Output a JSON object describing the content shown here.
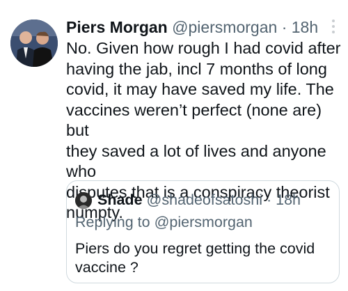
{
  "tweet": {
    "author_name": "Piers Morgan",
    "author_handle": "@piersmorgan",
    "separator": "·",
    "time": "18h",
    "text": "No. Given how rough I had covid after\nhaving the jab, incl 7 months of long\ncovid, it may have saved my life. The\nvaccines weren’t perfect (none are) but\nthey saved a lot of lives and anyone who\ndisputes that is a conspiracy theorist\nnumpty.",
    "more_icon": "more-vertical-icon"
  },
  "quoted_tweet": {
    "author_name": "Shade",
    "author_handle": "@shadeofsatoshi",
    "separator": "·",
    "time": "18h",
    "replying_prefix": "Replying to",
    "replying_to": "@piersmorgan",
    "text": "Piers do you regret getting the covid\nvaccine ?"
  },
  "colors": {
    "text_primary": "#0f1419",
    "text_secondary": "#536471",
    "border": "#cfd9de"
  }
}
